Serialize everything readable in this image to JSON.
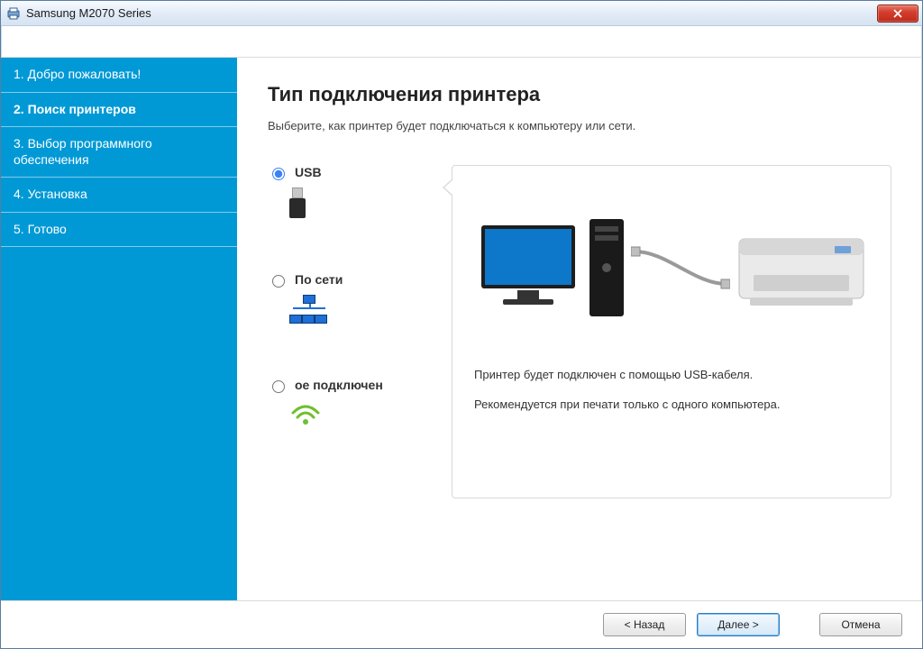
{
  "window": {
    "title": "Samsung M2070 Series"
  },
  "sidebar": {
    "items": [
      {
        "label": "1. Добро пожаловать!"
      },
      {
        "label": "2. Поиск принтеров"
      },
      {
        "label": "3. Выбор программного обеспечения"
      },
      {
        "label": "4. Установка"
      },
      {
        "label": "5. Готово"
      }
    ],
    "active_index": 1
  },
  "page": {
    "title": "Тип подключения принтера",
    "subtitle": "Выберите, как принтер будет подключаться к компьютеру или сети."
  },
  "options": {
    "usb": {
      "label": "USB",
      "checked": true
    },
    "network": {
      "label": "По сети",
      "checked": false
    },
    "wireless": {
      "label": "ое подключен",
      "checked": false
    }
  },
  "panel": {
    "line1": "Принтер будет подключен с помощью USB-кабеля.",
    "line2": "Рекомендуется при печати только с одного компьютера."
  },
  "footer": {
    "back": "< Назад",
    "next": "Далее >",
    "cancel": "Отмена"
  },
  "icons": {
    "close": "close-icon",
    "app": "printer-app-icon",
    "usb": "usb-stick-icon",
    "network": "network-icon",
    "wireless": "wifi-icon"
  }
}
